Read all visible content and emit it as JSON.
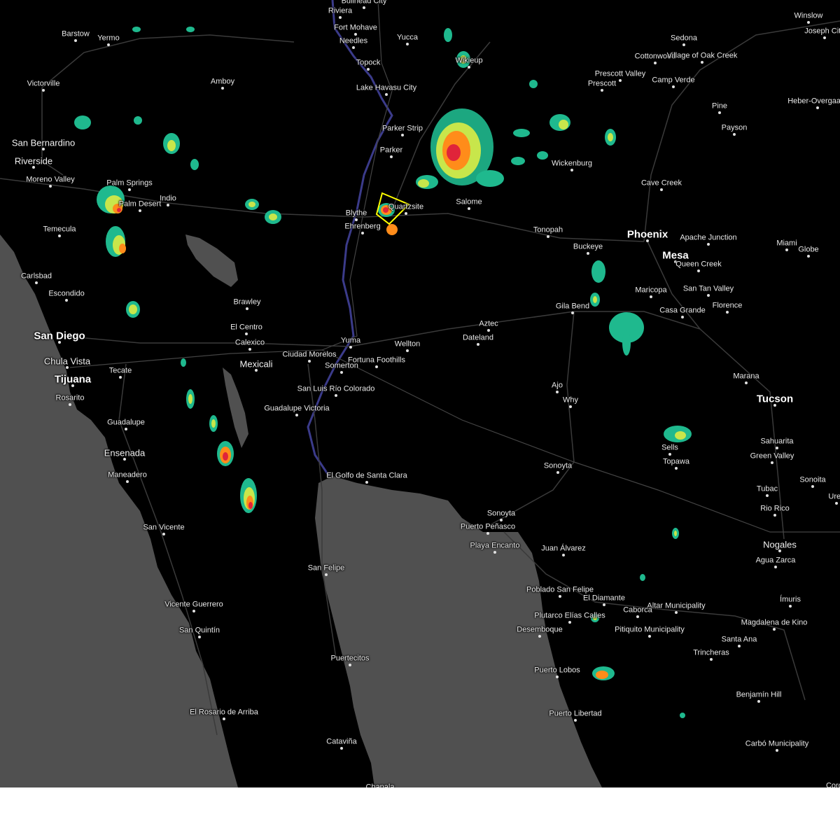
{
  "map": {
    "colors": {
      "land": "#000000",
      "water": "#505050",
      "roads": "#3a3a3a",
      "borders": "#444444",
      "warning_polygon": "#ffff00",
      "radar_light": "#1fb98e",
      "radar_mid": "#c8e64b",
      "radar_heavy": "#ff8c1a",
      "radar_extreme": "#e0243a"
    },
    "cities": [
      {
        "name": "Bullhead City",
        "size": "small"
      },
      {
        "name": "Riviera",
        "size": "small"
      },
      {
        "name": "Fort Mohave",
        "size": "small"
      },
      {
        "name": "Needles",
        "size": "small"
      },
      {
        "name": "Yucca",
        "size": "small"
      },
      {
        "name": "Winslow",
        "size": "small"
      },
      {
        "name": "Joseph City",
        "size": "small"
      },
      {
        "name": "Barstow",
        "size": "small"
      },
      {
        "name": "Yermo",
        "size": "small"
      },
      {
        "name": "Sedona",
        "size": "small"
      },
      {
        "name": "Cottonwood",
        "size": "small"
      },
      {
        "name": "Village of Oak Creek",
        "size": "small"
      },
      {
        "name": "Wikieup",
        "size": "small"
      },
      {
        "name": "Topock",
        "size": "small"
      },
      {
        "name": "Lake Havasu City",
        "size": "small"
      },
      {
        "name": "Prescott Valley",
        "size": "small"
      },
      {
        "name": "Prescott",
        "size": "small"
      },
      {
        "name": "Camp Verde",
        "size": "small"
      },
      {
        "name": "Victorville",
        "size": "small"
      },
      {
        "name": "Amboy",
        "size": "small"
      },
      {
        "name": "Pine",
        "size": "small"
      },
      {
        "name": "Heber-Overgaard",
        "size": "small"
      },
      {
        "name": "Payson",
        "size": "small"
      },
      {
        "name": "Parker Strip",
        "size": "small"
      },
      {
        "name": "Parker",
        "size": "small"
      },
      {
        "name": "San Bernardino",
        "size": "mid"
      },
      {
        "name": "Riverside",
        "size": "mid"
      },
      {
        "name": "Moreno Valley",
        "size": "small"
      },
      {
        "name": "Wickenburg",
        "size": "small"
      },
      {
        "name": "Quartzsite",
        "size": "small"
      },
      {
        "name": "Salome",
        "size": "small"
      },
      {
        "name": "Cave Creek",
        "size": "small"
      },
      {
        "name": "Palm Springs",
        "size": "small"
      },
      {
        "name": "Palm Desert",
        "size": "small"
      },
      {
        "name": "Indio",
        "size": "small"
      },
      {
        "name": "Blythe",
        "size": "small"
      },
      {
        "name": "Ehrenberg",
        "size": "small"
      },
      {
        "name": "Temecula",
        "size": "small"
      },
      {
        "name": "Tonopah",
        "size": "small"
      },
      {
        "name": "Phoenix",
        "size": "big"
      },
      {
        "name": "Apache Junction",
        "size": "small"
      },
      {
        "name": "Buckeye",
        "size": "small"
      },
      {
        "name": "Mesa",
        "size": "big"
      },
      {
        "name": "Miami",
        "size": "small"
      },
      {
        "name": "Globe",
        "size": "small"
      },
      {
        "name": "Queen Creek",
        "size": "small"
      },
      {
        "name": "Carlsbad",
        "size": "small"
      },
      {
        "name": "San Tan Valley",
        "size": "small"
      },
      {
        "name": "Maricopa",
        "size": "small"
      },
      {
        "name": "Escondido",
        "size": "small"
      },
      {
        "name": "Brawley",
        "size": "small"
      },
      {
        "name": "Gila Bend",
        "size": "small"
      },
      {
        "name": "Florence",
        "size": "small"
      },
      {
        "name": "Casa Grande",
        "size": "small"
      },
      {
        "name": "Aztec",
        "size": "small"
      },
      {
        "name": "El Centro",
        "size": "small"
      },
      {
        "name": "San Diego",
        "size": "big"
      },
      {
        "name": "Dateland",
        "size": "small"
      },
      {
        "name": "Yuma",
        "size": "small"
      },
      {
        "name": "Calexico",
        "size": "small"
      },
      {
        "name": "Wellton",
        "size": "small"
      },
      {
        "name": "Ciudad Morelos",
        "size": "small"
      },
      {
        "name": "Chula Vista",
        "size": "mid"
      },
      {
        "name": "Fortuna Foothills",
        "size": "small"
      },
      {
        "name": "Mexicali",
        "size": "mid"
      },
      {
        "name": "Somerton",
        "size": "small"
      },
      {
        "name": "Tijuana",
        "size": "big"
      },
      {
        "name": "Tecate",
        "size": "small"
      },
      {
        "name": "San Luis Río Colorado",
        "size": "small"
      },
      {
        "name": "Marana",
        "size": "small"
      },
      {
        "name": "Ajo",
        "size": "small"
      },
      {
        "name": "Guadalupe Victoria",
        "size": "small"
      },
      {
        "name": "Rosarito",
        "size": "small"
      },
      {
        "name": "Tucson",
        "size": "big"
      },
      {
        "name": "Why",
        "size": "small"
      },
      {
        "name": "Guadalupe",
        "size": "small"
      },
      {
        "name": "Sells",
        "size": "small"
      },
      {
        "name": "Sahuarita",
        "size": "small"
      },
      {
        "name": "Ensenada",
        "size": "mid"
      },
      {
        "name": "Topawa",
        "size": "small"
      },
      {
        "name": "Green Valley",
        "size": "small"
      },
      {
        "name": "Sonoyta",
        "size": "small"
      },
      {
        "name": "El Golfo de Santa Clara",
        "size": "small"
      },
      {
        "name": "Maneadero",
        "size": "small"
      },
      {
        "name": "Sonoita",
        "size": "small"
      },
      {
        "name": "Tubac",
        "size": "small"
      },
      {
        "name": "Rio Rico",
        "size": "small"
      },
      {
        "name": "Sonoyta",
        "size": "small"
      },
      {
        "name": "San Vicente",
        "size": "small"
      },
      {
        "name": "Puerto Peñasco",
        "size": "small"
      },
      {
        "name": "Playa Encanto",
        "size": "small"
      },
      {
        "name": "Nogales",
        "size": "mid"
      },
      {
        "name": "Juan Álvarez",
        "size": "small"
      },
      {
        "name": "Agua Zarca",
        "size": "small"
      },
      {
        "name": "San Felipe",
        "size": "small"
      },
      {
        "name": "Poblado San Felipe",
        "size": "small"
      },
      {
        "name": "El Diamante",
        "size": "small"
      },
      {
        "name": "Ímuris",
        "size": "small"
      },
      {
        "name": "Vicente Guerrero",
        "size": "small"
      },
      {
        "name": "Altar Municipality",
        "size": "small"
      },
      {
        "name": "Plutarco Elías Calles",
        "size": "small"
      },
      {
        "name": "Caborca",
        "size": "small"
      },
      {
        "name": "Magdalena de Kino",
        "size": "small"
      },
      {
        "name": "Pitiquito Municipality",
        "size": "small"
      },
      {
        "name": "San Quintín",
        "size": "small"
      },
      {
        "name": "Desemboque",
        "size": "small"
      },
      {
        "name": "Santa Ana",
        "size": "small"
      },
      {
        "name": "Trincheras",
        "size": "small"
      },
      {
        "name": "Puertecitos",
        "size": "small"
      },
      {
        "name": "Puerto Lobos",
        "size": "small"
      },
      {
        "name": "Benjamín Hill",
        "size": "small"
      },
      {
        "name": "El Rosario de Arriba",
        "size": "small"
      },
      {
        "name": "Puerto Libertad",
        "size": "small"
      },
      {
        "name": "Carbó Municipality",
        "size": "small"
      },
      {
        "name": "Cataviña",
        "size": "small"
      },
      {
        "name": "Chapala",
        "size": "small"
      },
      {
        "name": "Ures",
        "size": "small"
      },
      {
        "name": "Corona",
        "size": "small"
      }
    ]
  }
}
